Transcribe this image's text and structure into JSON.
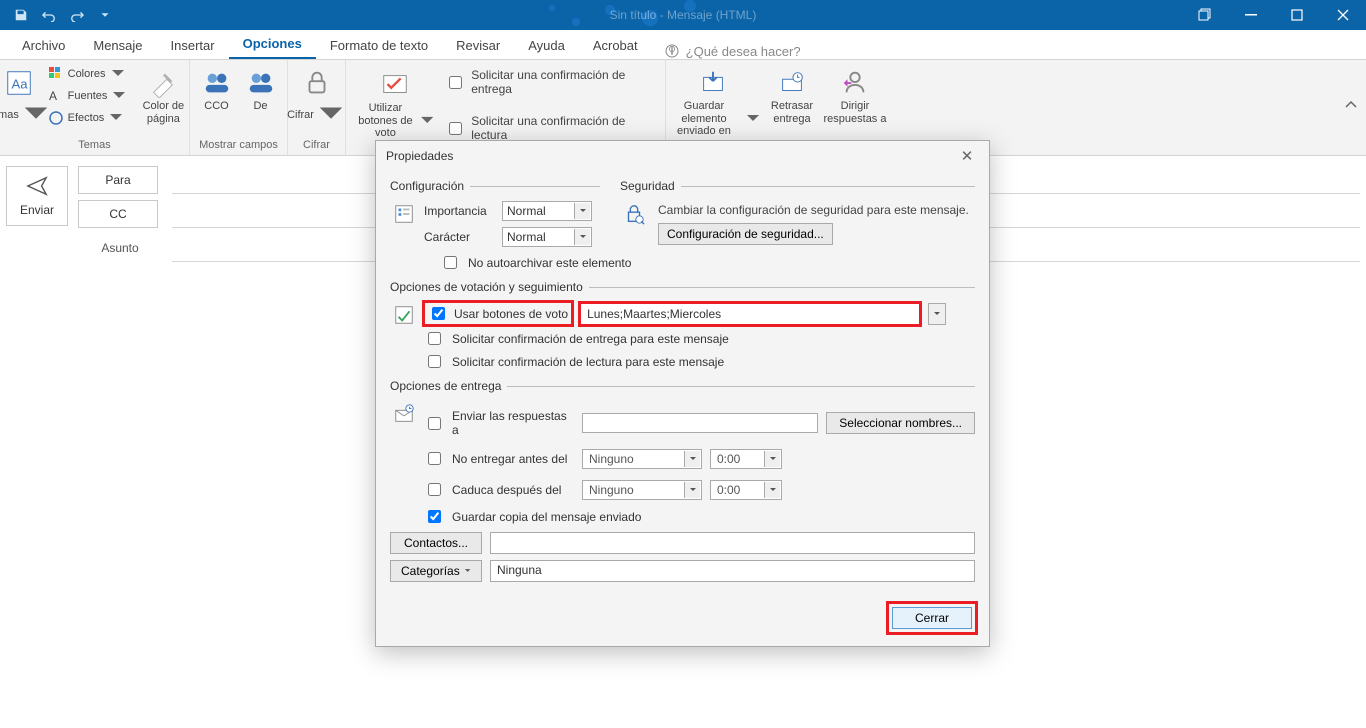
{
  "title": "Sin título  -  Mensaje (HTML)",
  "qat": {
    "save": "save-icon",
    "undo": "undo-icon",
    "redo": "redo-icon"
  },
  "tabs": {
    "items": [
      "Archivo",
      "Mensaje",
      "Insertar",
      "Opciones",
      "Formato de texto",
      "Revisar",
      "Ayuda",
      "Acrobat"
    ],
    "active": "Opciones",
    "tellme": "¿Qué desea hacer?"
  },
  "ribbon": {
    "themes": {
      "label": "Temas",
      "btn": "Temas",
      "colors": "Colores",
      "fonts": "Fuentes",
      "effects": "Efectos",
      "pageColor": "Color de página"
    },
    "showFields": {
      "label": "Mostrar campos",
      "cco": "CCO",
      "de": "De"
    },
    "encrypt": {
      "label": "Cifrar",
      "btn": "Cifrar"
    },
    "vote": {
      "btn": "Utilizar botones de voto",
      "deliveryReceipt": "Solicitar una confirmación de entrega",
      "readReceipt": "Solicitar una confirmación de lectura"
    },
    "more": {
      "saveSent": "Guardar elemento enviado en",
      "delay": "Retrasar entrega",
      "direct": "Dirigir respuestas a"
    }
  },
  "compose": {
    "send": "Enviar",
    "para": "Para",
    "cc": "CC",
    "asunto": "Asunto"
  },
  "dialog": {
    "title": "Propiedades",
    "config": {
      "legend": "Configuración",
      "importanceLabel": "Importancia",
      "importanceValue": "Normal",
      "sensitivityLabel": "Carácter",
      "sensitivityValue": "Normal",
      "noAutoArchive": "No autoarchivar este elemento"
    },
    "security": {
      "legend": "Seguridad",
      "desc": "Cambiar la configuración de seguridad para este mensaje.",
      "btn": "Configuración de seguridad..."
    },
    "voting": {
      "legend": "Opciones de votación y seguimiento",
      "useVotingButtons": "Usar botones de voto",
      "votingValue": "Lunes;Maartes;Miercoles",
      "confirmDelivery": "Solicitar confirmación de entrega para este mensaje",
      "confirmRead": "Solicitar confirmación de lectura para este mensaje"
    },
    "delivery": {
      "legend": "Opciones de entrega",
      "sendRepliesTo": "Enviar las respuestas a",
      "selectNames": "Seleccionar nombres...",
      "noDeliverBefore": "No entregar antes del",
      "expiresAfter": "Caduca después del",
      "none": "Ninguno",
      "zeroTime": "0:00",
      "saveCopy": "Guardar copia del mensaje enviado",
      "contacts": "Contactos...",
      "categories": "Categorías",
      "categoriesValue": "Ninguna"
    },
    "close": "Cerrar"
  }
}
